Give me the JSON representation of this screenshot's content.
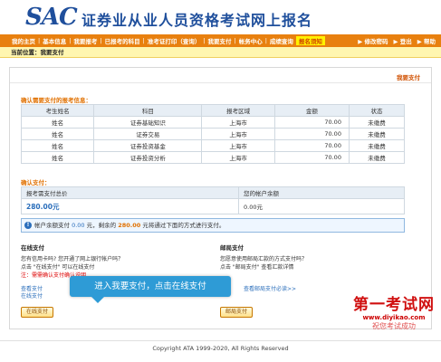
{
  "brand": {
    "logo": "SAC",
    "title": "证券业从业人员资格考试网上报名"
  },
  "nav": {
    "items": [
      "我的主页",
      "基本信息",
      "我要报考",
      "已报考的科目",
      "准考证打印（查询）",
      "我要支付",
      "帐务中心",
      "成绩查询"
    ],
    "active": "报名须知",
    "right": [
      "▶ 修改密码",
      "▶ 登出",
      "▶ 帮助"
    ]
  },
  "location": "当前位置：我要支付",
  "panel_title": "我要支付",
  "fees": {
    "title": "确认需要支付的报考信息：",
    "headers": [
      "考生姓名",
      "科目",
      "报考区域",
      "金额",
      "状态"
    ],
    "rows": [
      [
        "姓名",
        "证券基础知识",
        "上海市",
        "70.00",
        "未缴费"
      ],
      [
        "姓名",
        "证券交易",
        "上海市",
        "70.00",
        "未缴费"
      ],
      [
        "姓名",
        "证券投资基金",
        "上海市",
        "70.00",
        "未缴费"
      ],
      [
        "姓名",
        "证券投资分析",
        "上海市",
        "70.00",
        "未缴费"
      ]
    ]
  },
  "payment": {
    "title": "确认支付：",
    "total_label": "报考需支付总价",
    "balance_label": "您的帐户余额",
    "total_value": "280.00元",
    "balance_value": "0.00元"
  },
  "info": {
    "icon": "info-icon",
    "p1": "帐户余额支付",
    "balance": "0.00",
    "p2": "元，剩余的",
    "remaining": "280.00",
    "p3": "元将通过下面的方式进行支付。"
  },
  "online": {
    "title": "在线支付",
    "line1": "您有信用卡吗? 您开通了网上银行帐户吗？",
    "line2": "点击 \"在线支付\" 可以在线支付",
    "line3": "注：需需确认支付确认说明",
    "line4": "查看支付",
    "line5": "在线支付",
    "button": "在线支付"
  },
  "postal": {
    "title": "邮局支付",
    "line1": "您愿意使用邮局汇款的方式支付吗？",
    "line2": "点击 \"邮局支付\" 查看汇款详情",
    "line3": "查看邮局支付必读>>",
    "button": "邮局支付"
  },
  "tooltip": "进入我要支付，点击在线支付",
  "footer": "Copyright ATA 1999-2020, All Rights Reserved",
  "watermark": {
    "title": "第一考试网",
    "url": "www.diyikao.com",
    "slogan": "祝您考试成功"
  },
  "colors": {
    "nav": "#e8800f",
    "accent": "#e07000",
    "link": "#2a6ebb",
    "tooltip": "#2e9bd6"
  }
}
